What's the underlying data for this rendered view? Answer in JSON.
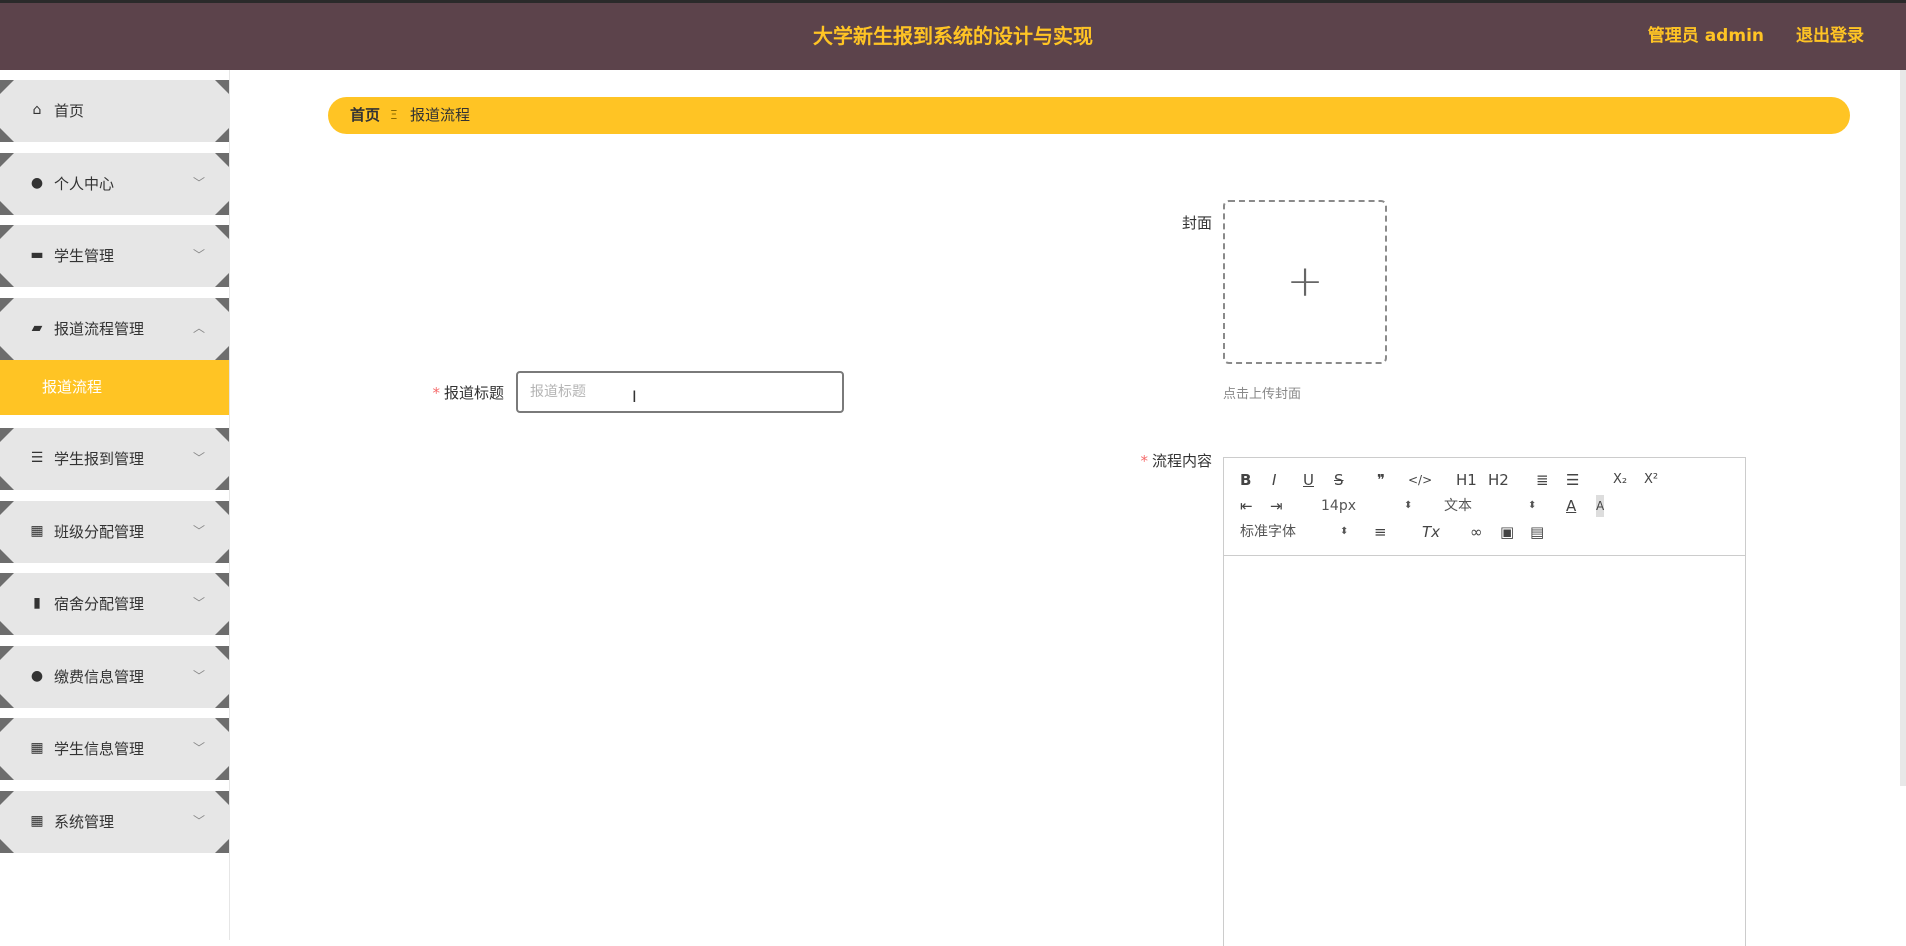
{
  "header": {
    "title": "大学新生报到系统的设计与实现",
    "user": "管理员 admin",
    "logout": "退出登录"
  },
  "sidebar": {
    "items": [
      {
        "label": "首页",
        "icon": "home-icon"
      },
      {
        "label": "个人中心",
        "icon": "user-icon"
      },
      {
        "label": "学生管理",
        "icon": "monitor-icon"
      },
      {
        "label": "报道流程管理",
        "icon": "wallet-icon"
      },
      {
        "label": "学生报到管理",
        "icon": "list-icon"
      },
      {
        "label": "班级分配管理",
        "icon": "grid-icon"
      },
      {
        "label": "宿舍分配管理",
        "icon": "book-icon"
      },
      {
        "label": "缴费信息管理",
        "icon": "bulb-icon"
      },
      {
        "label": "学生信息管理",
        "icon": "grid-icon"
      },
      {
        "label": "系统管理",
        "icon": "grid-icon"
      }
    ],
    "active_sub": "报道流程"
  },
  "breadcrumb": {
    "home": "首页",
    "separator": "Ξ",
    "current": "报道流程"
  },
  "form": {
    "cover_label": "封面",
    "cover_hint": "点击上传封面",
    "title_label": "报道标题",
    "title_placeholder": "报道标题",
    "title_value": "",
    "content_label": "流程内容",
    "required_mark": "*"
  },
  "editor": {
    "font_size": "14px",
    "paragraph": "文本",
    "font_family": "标准字体",
    "buttons": {
      "bold": "B",
      "italic": "I",
      "underline": "U",
      "strike": "S",
      "quote": "❞",
      "code": "</>",
      "h1": "H1",
      "h2": "H2",
      "ordered_list": "≣",
      "bullet_list": "☰",
      "subscript": "X₂",
      "superscript": "X²"
    }
  },
  "colors": {
    "header_bg": "#5c434b",
    "accent": "#ffc424",
    "required": "#f56c6c"
  }
}
